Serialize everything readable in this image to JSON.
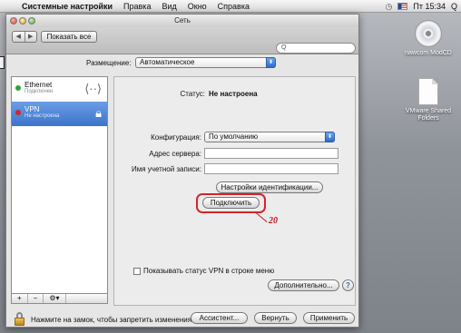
{
  "menubar": {
    "apple": "",
    "app": "Системные настройки",
    "items": [
      "Правка",
      "Вид",
      "Окно",
      "Справка"
    ],
    "clock": "Пт 15:34",
    "time_icon": "clock-icon",
    "search_icon": "Q"
  },
  "window": {
    "title": "Сеть",
    "nav_back": "◀",
    "nav_forward": "▶",
    "show_all": "Показать все",
    "search_placeholder": "Q"
  },
  "location": {
    "label": "Размещение:",
    "value": "Автоматическое"
  },
  "services": [
    {
      "name": "Ethernet",
      "status": "Подключен",
      "dot": "#2fa33a",
      "icon": "ethernet-arrows-icon"
    },
    {
      "name": "VPN",
      "status": "Не настроена",
      "dot": "#d02828",
      "icon": "lock-icon"
    }
  ],
  "list_tools": {
    "add": "+",
    "remove": "−",
    "action": "⚙▾"
  },
  "detail": {
    "status_label": "Статус:",
    "status_value": "Не настроена",
    "config_label": "Конфигурация:",
    "config_value": "По умолчанию",
    "server_label": "Адрес сервера:",
    "server_value": "",
    "account_label": "Имя учетной записи:",
    "account_value": "",
    "auth_button": "Настройки идентификации...",
    "connect_button": "Подключить",
    "annotation_number": "20",
    "show_vpn_status": "Показывать статус VPN в строке меню",
    "advanced_button": "Дополнительно...",
    "help": "?"
  },
  "bottom": {
    "lock_text": "Нажмите на замок, чтобы запретить изменения.",
    "assistant": "Ассистент...",
    "revert": "Вернуть",
    "apply": "Применить"
  },
  "desktop": {
    "cd_label": "nawcom ModCD",
    "vmware_label": "VMware Shared Folders"
  },
  "colors": {
    "selection": "#3d73c9",
    "annotation": "#d8232a",
    "connected": "#2fa33a",
    "disconnected": "#d02828"
  }
}
